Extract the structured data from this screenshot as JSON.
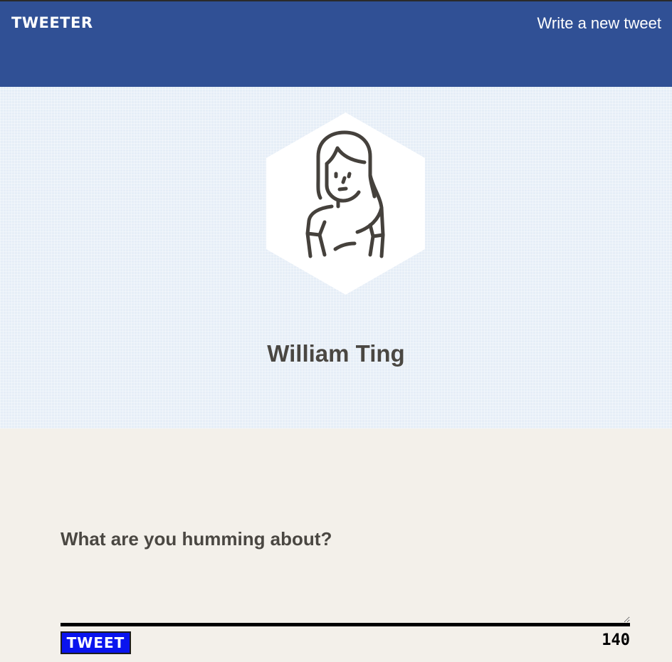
{
  "nav": {
    "brand": "TWEETER",
    "compose_link": "Write a new tweet"
  },
  "profile": {
    "name": "William Ting",
    "avatar_icon": "user-avatar-icon"
  },
  "compose": {
    "prompt": "What are you humming about?",
    "input_value": "",
    "button_label": "TWEET",
    "char_count": "140"
  },
  "colors": {
    "nav_background": "#305095",
    "profile_background": "#e6eef7",
    "compose_background": "#f3f0ea",
    "button_background": "#0a14ee",
    "heading_text": "#4a4742"
  }
}
